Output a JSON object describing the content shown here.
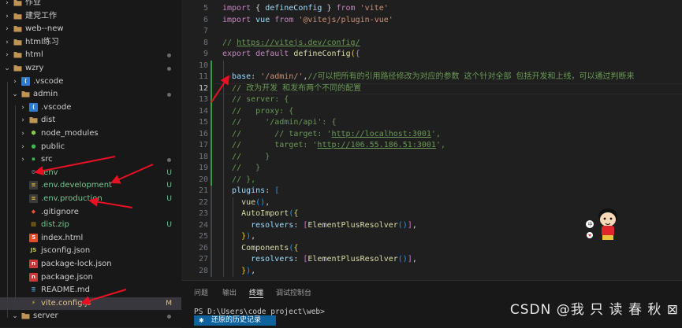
{
  "explorer": {
    "items": [
      {
        "label": "作业",
        "chevron": "›",
        "icon": "folder",
        "depth": 0,
        "badge": "",
        "dot": false
      },
      {
        "label": "建党工作",
        "chevron": "›",
        "icon": "folder",
        "depth": 0,
        "badge": "",
        "dot": false
      },
      {
        "label": "web--new",
        "chevron": "›",
        "icon": "folder",
        "depth": 0,
        "badge": "",
        "dot": false
      },
      {
        "label": "html练习",
        "chevron": "›",
        "icon": "folder",
        "depth": 0,
        "badge": "",
        "dot": false
      },
      {
        "label": "html",
        "chevron": "›",
        "icon": "folder",
        "depth": 0,
        "badge": "",
        "dot": true
      },
      {
        "label": "wzry",
        "chevron": "⌄",
        "icon": "folder",
        "depth": 0,
        "badge": "",
        "dot": true
      },
      {
        "label": ".vscode",
        "chevron": "›",
        "icon": "vscode",
        "depth": 1,
        "badge": "",
        "dot": false
      },
      {
        "label": "admin",
        "chevron": "⌄",
        "icon": "folder",
        "depth": 1,
        "badge": "",
        "dot": true
      },
      {
        "label": ".vscode",
        "chevron": "›",
        "icon": "vscode",
        "depth": 2,
        "badge": "",
        "dot": false
      },
      {
        "label": "dist",
        "chevron": "›",
        "icon": "folder",
        "depth": 2,
        "badge": "",
        "dot": false
      },
      {
        "label": "node_modules",
        "chevron": "›",
        "icon": "node",
        "depth": 2,
        "badge": "",
        "dot": false
      },
      {
        "label": "public",
        "chevron": "›",
        "icon": "public",
        "depth": 2,
        "badge": "",
        "dot": false
      },
      {
        "label": "src",
        "chevron": "›",
        "icon": "src",
        "depth": 2,
        "badge": "",
        "dot": true
      },
      {
        "label": ".env",
        "chevron": "",
        "icon": "gear",
        "depth": 2,
        "badge": "U",
        "dot": false
      },
      {
        "label": ".env.development",
        "chevron": "",
        "icon": "env",
        "depth": 2,
        "badge": "U",
        "dot": false
      },
      {
        "label": ".env.production",
        "chevron": "",
        "icon": "env",
        "depth": 2,
        "badge": "U",
        "dot": false
      },
      {
        "label": ".gitignore",
        "chevron": "",
        "icon": "git",
        "depth": 2,
        "badge": "",
        "dot": false
      },
      {
        "label": "dist.zip",
        "chevron": "",
        "icon": "zip",
        "depth": 2,
        "badge": "U",
        "dot": false
      },
      {
        "label": "index.html",
        "chevron": "",
        "icon": "html",
        "depth": 2,
        "badge": "",
        "dot": false
      },
      {
        "label": "jsconfig.json",
        "chevron": "",
        "icon": "js",
        "depth": 2,
        "badge": "",
        "dot": false
      },
      {
        "label": "package-lock.json",
        "chevron": "",
        "icon": "npm",
        "depth": 2,
        "badge": "",
        "dot": false
      },
      {
        "label": "package.json",
        "chevron": "",
        "icon": "npm",
        "depth": 2,
        "badge": "",
        "dot": false
      },
      {
        "label": "README.md",
        "chevron": "",
        "icon": "md",
        "depth": 2,
        "badge": "",
        "dot": false
      },
      {
        "label": "vite.config.js",
        "chevron": "",
        "icon": "vite",
        "depth": 2,
        "badge": "M",
        "dot": false,
        "active": true
      },
      {
        "label": "server",
        "chevron": "⌄",
        "icon": "folder",
        "depth": 1,
        "badge": "",
        "dot": true
      }
    ]
  },
  "editor": {
    "lines": [
      {
        "n": "5",
        "tokens": [
          [
            "import",
            "#c586c0"
          ],
          [
            " { ",
            "#d4d4d4"
          ],
          [
            "defineConfig",
            "#9cdcfe"
          ],
          [
            " } ",
            "#d4d4d4"
          ],
          [
            "from",
            "#c586c0"
          ],
          [
            " ",
            "#d4d4d4"
          ],
          [
            "'vite'",
            "#ce9178"
          ]
        ]
      },
      {
        "n": "6",
        "tokens": [
          [
            "import",
            "#c586c0"
          ],
          [
            " ",
            "#d4d4d4"
          ],
          [
            "vue",
            "#9cdcfe"
          ],
          [
            " ",
            "#d4d4d4"
          ],
          [
            "from",
            "#c586c0"
          ],
          [
            " ",
            "#d4d4d4"
          ],
          [
            "'@vitejs/plugin-vue'",
            "#ce9178"
          ]
        ]
      },
      {
        "n": "7",
        "tokens": []
      },
      {
        "n": "8",
        "tokens": [
          [
            "// ",
            "#6a9955"
          ],
          [
            "https://vitejs.dev/config/",
            "#6a9955"
          ]
        ]
      },
      {
        "n": "9",
        "tokens": [
          [
            "export",
            "#c586c0"
          ],
          [
            " ",
            "#d4d4d4"
          ],
          [
            "default",
            "#c586c0"
          ],
          [
            " ",
            "#d4d4d4"
          ],
          [
            "defineConfig",
            "#dcdcaa"
          ],
          [
            "(",
            "#ffd700"
          ],
          [
            "{",
            "#da70d6"
          ]
        ]
      },
      {
        "n": "10",
        "tokens": []
      },
      {
        "n": "11",
        "tokens": [
          [
            "  ",
            "#d4d4d4"
          ],
          [
            "base",
            "#9cdcfe"
          ],
          [
            ": ",
            "#d4d4d4"
          ],
          [
            "'/admin/'",
            "#ce9178"
          ],
          [
            ",",
            "#d4d4d4"
          ],
          [
            "//可以把所有的引用路径修改为对应的参数 这个针对全部 包括开发和上线，可以通过判断来",
            "#6a9955"
          ]
        ]
      },
      {
        "n": "12",
        "tokens": [
          [
            "  ",
            "#d4d4d4"
          ],
          [
            "// 改为开发 和发布两个不同的配置",
            "#6a9955"
          ]
        ]
      },
      {
        "n": "13",
        "tokens": [
          [
            "  ",
            "#d4d4d4"
          ],
          [
            "// server: {",
            "#6a9955"
          ]
        ]
      },
      {
        "n": "14",
        "tokens": [
          [
            "  ",
            "#d4d4d4"
          ],
          [
            "//   proxy: {",
            "#6a9955"
          ]
        ]
      },
      {
        "n": "15",
        "tokens": [
          [
            "  ",
            "#d4d4d4"
          ],
          [
            "//     '/admin/api': {",
            "#6a9955"
          ]
        ]
      },
      {
        "n": "16",
        "tokens": [
          [
            "  ",
            "#d4d4d4"
          ],
          [
            "//       // target: '",
            "#6a9955"
          ],
          [
            "http://localhost:3001",
            "#6a9955"
          ],
          [
            "',",
            "#6a9955"
          ]
        ]
      },
      {
        "n": "17",
        "tokens": [
          [
            "  ",
            "#d4d4d4"
          ],
          [
            "//       target: '",
            "#6a9955"
          ],
          [
            "http://106.55.186.51:3001",
            "#6a9955"
          ],
          [
            "',",
            "#6a9955"
          ]
        ]
      },
      {
        "n": "18",
        "tokens": [
          [
            "  ",
            "#d4d4d4"
          ],
          [
            "//     }",
            "#6a9955"
          ]
        ]
      },
      {
        "n": "19",
        "tokens": [
          [
            "  ",
            "#d4d4d4"
          ],
          [
            "//   }",
            "#6a9955"
          ]
        ]
      },
      {
        "n": "20",
        "tokens": [
          [
            "  ",
            "#d4d4d4"
          ],
          [
            "// },",
            "#6a9955"
          ]
        ]
      },
      {
        "n": "21",
        "tokens": [
          [
            "  ",
            "#d4d4d4"
          ],
          [
            "plugins",
            "#9cdcfe"
          ],
          [
            ": ",
            "#d4d4d4"
          ],
          [
            "[",
            "#179fff"
          ]
        ]
      },
      {
        "n": "22",
        "tokens": [
          [
            "    ",
            "#d4d4d4"
          ],
          [
            "vue",
            "#dcdcaa"
          ],
          [
            "()",
            "#179fff"
          ],
          [
            ",",
            "#d4d4d4"
          ]
        ]
      },
      {
        "n": "23",
        "tokens": [
          [
            "    ",
            "#d4d4d4"
          ],
          [
            "AutoImport",
            "#dcdcaa"
          ],
          [
            "(",
            "#179fff"
          ],
          [
            "{",
            "#ffd700"
          ]
        ]
      },
      {
        "n": "24",
        "tokens": [
          [
            "      ",
            "#d4d4d4"
          ],
          [
            "resolvers",
            "#9cdcfe"
          ],
          [
            ": ",
            "#d4d4d4"
          ],
          [
            "[",
            "#da70d6"
          ],
          [
            "ElementPlusResolver",
            "#dcdcaa"
          ],
          [
            "()",
            "#179fff"
          ],
          [
            "]",
            "#da70d6"
          ],
          [
            ",",
            "#d4d4d4"
          ]
        ]
      },
      {
        "n": "25",
        "tokens": [
          [
            "    ",
            "#d4d4d4"
          ],
          [
            "}",
            "#ffd700"
          ],
          [
            ")",
            "#179fff"
          ],
          [
            ",",
            "#d4d4d4"
          ]
        ]
      },
      {
        "n": "26",
        "tokens": [
          [
            "    ",
            "#d4d4d4"
          ],
          [
            "Components",
            "#dcdcaa"
          ],
          [
            "(",
            "#179fff"
          ],
          [
            "{",
            "#ffd700"
          ]
        ]
      },
      {
        "n": "27",
        "tokens": [
          [
            "      ",
            "#d4d4d4"
          ],
          [
            "resolvers",
            "#9cdcfe"
          ],
          [
            ": ",
            "#d4d4d4"
          ],
          [
            "[",
            "#da70d6"
          ],
          [
            "ElementPlusResolver",
            "#dcdcaa"
          ],
          [
            "()",
            "#179fff"
          ],
          [
            "]",
            "#da70d6"
          ],
          [
            ",",
            "#d4d4d4"
          ]
        ]
      },
      {
        "n": "28",
        "tokens": [
          [
            "    ",
            "#d4d4d4"
          ],
          [
            "}",
            "#ffd700"
          ],
          [
            ")",
            "#179fff"
          ],
          [
            ",",
            "#d4d4d4"
          ]
        ]
      }
    ],
    "current_line": "12"
  },
  "panel": {
    "tabs": [
      "问题",
      "输出",
      "终端",
      "调试控制台"
    ],
    "active_tab": "终端",
    "prompt": "PS D:\\Users\\code_project\\web>",
    "restore_icon": "✱",
    "restore_text": "还原的历史记录"
  },
  "watermark": "CSDN @我 只 读 春 秋 ⊠",
  "colors": {
    "accent": "#0e639c",
    "git_added": "#2ea043",
    "annotation_red": "#e81123"
  }
}
